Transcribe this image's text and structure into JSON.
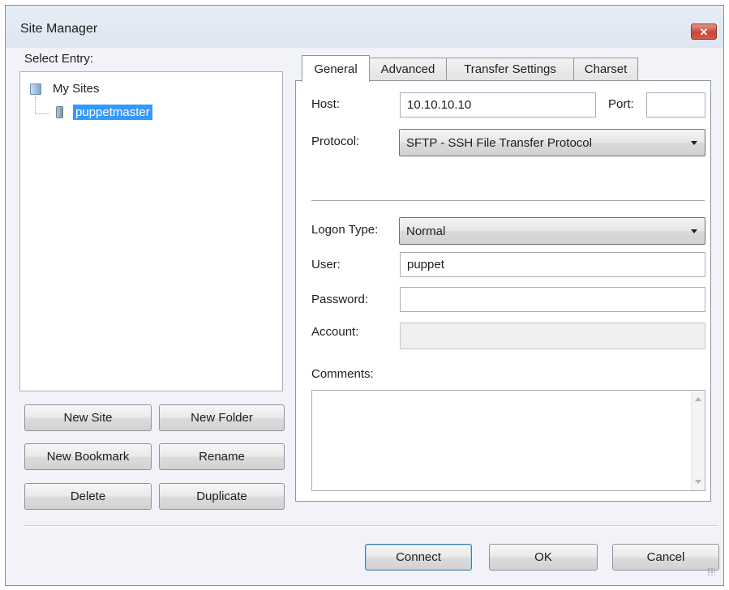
{
  "window": {
    "title": "Site Manager",
    "close_icon": "close-icon",
    "close_symbol": "✕"
  },
  "tree": {
    "label": "Select Entry:",
    "root": {
      "label": "My Sites",
      "icon": "folder-icon"
    },
    "children": [
      {
        "label": "puppetmaster",
        "icon": "site-icon",
        "selected": true
      }
    ]
  },
  "left_buttons": {
    "new_site": "New Site",
    "new_folder": "New Folder",
    "new_bookmark": "New Bookmark",
    "rename": "Rename",
    "delete": "Delete",
    "duplicate": "Duplicate"
  },
  "tabs": [
    {
      "label": "General",
      "active": true
    },
    {
      "label": "Advanced",
      "active": false
    },
    {
      "label": "Transfer Settings",
      "active": false
    },
    {
      "label": "Charset",
      "active": false
    }
  ],
  "general": {
    "host_label": "Host:",
    "host_value": "10.10.10.10",
    "port_label": "Port:",
    "port_value": "",
    "protocol_label": "Protocol:",
    "protocol_value": "SFTP - SSH File Transfer Protocol",
    "logon_type_label": "Logon Type:",
    "logon_type_value": "Normal",
    "user_label": "User:",
    "user_value": "puppet",
    "password_label": "Password:",
    "password_value": "",
    "account_label": "Account:",
    "account_value": "",
    "comments_label": "Comments:",
    "comments_value": ""
  },
  "footer_buttons": {
    "connect": "Connect",
    "ok": "OK",
    "cancel": "Cancel"
  },
  "colors": {
    "selection": "#3399ff",
    "close_button": "#c7493a",
    "titlebar": "#dde6f1"
  }
}
